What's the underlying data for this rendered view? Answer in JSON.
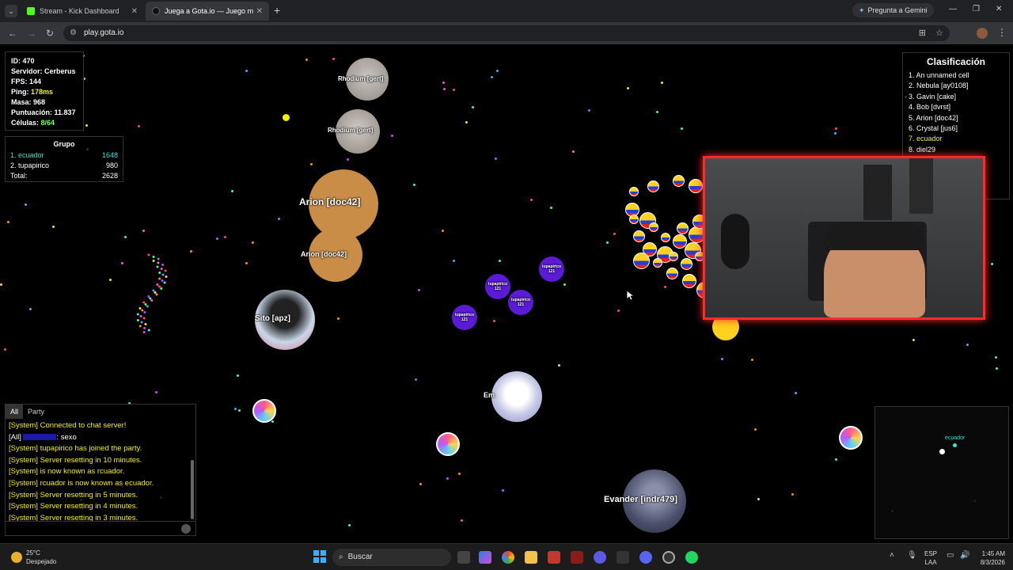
{
  "browser": {
    "tabs": [
      {
        "label": "Stream - Kick Dashboard",
        "active": false
      },
      {
        "label": "Juega a Gota.io — Juego multi",
        "active": true
      }
    ],
    "gemini_label": "Pregunta a Gemini",
    "url": "play.gota.io"
  },
  "stats": {
    "id": "ID: 470",
    "server": "Servidor: Cerberus",
    "fps": "FPS: 144",
    "ping_label": "Ping: ",
    "ping_value": "178ms",
    "mass": "Masa: 968",
    "score": "Puntuación: 11.837",
    "cells_label": "Células: ",
    "cells_value": "8/64"
  },
  "group": {
    "title": "Grupo",
    "rows": [
      {
        "name": "1. ecuador",
        "value": "1648"
      },
      {
        "name": "2. tupapirico",
        "value": "980"
      },
      {
        "name": "Total:",
        "value": "2628"
      }
    ]
  },
  "leaderboard": {
    "title": "Clasificación",
    "items": [
      "1. An unnamed cell",
      "2. Nebula [ay0108]",
      "3. Gavin [cake]",
      "4. Bob [dvrst]",
      "5. Arion [doc42]",
      "6. Crystal [jus6]",
      "7. ecuador",
      "8. diel29"
    ]
  },
  "cells": {
    "rhodium1": "Rhodium [gert]",
    "rhodium2": "Rhodium [gert]",
    "arion1": "Arion [doc42]",
    "arion2": "Arion [doc42]",
    "sito": "Sito [apz]",
    "tupa1": "tupapirico",
    "tupa1_mass": "121",
    "tupa2": "tupapirico",
    "tupa2_mass": "121",
    "tupa3": "tupapirico",
    "tupa3_mass": "121",
    "tupa4": "tupapirico",
    "tupa4_mass": "121",
    "em": "Em",
    "evander": "Evander [indr479]"
  },
  "chat": {
    "tabs": [
      "All",
      "Party"
    ],
    "messages": [
      {
        "type": "sys",
        "text": "[System] Connected to chat server!"
      },
      {
        "type": "all",
        "prefix": "[All] ",
        "text": ": sexo"
      },
      {
        "type": "sys",
        "text": "[System] tupapirico has joined the party."
      },
      {
        "type": "sys",
        "text": "[System] Server resetting in 10 minutes."
      },
      {
        "type": "sys",
        "text": "[System] is now known as rcuador."
      },
      {
        "type": "sys",
        "text": "[System] rcuador is now known as ecuador."
      },
      {
        "type": "sys",
        "text": "[System] Server resetting in 5 minutes."
      },
      {
        "type": "sys",
        "text": "[System] Server resetting in 4 minutes."
      },
      {
        "type": "sys",
        "text": "[System] Server resetting in 3 minutes."
      }
    ]
  },
  "minimap": {
    "player_label": "ecuador"
  },
  "taskbar": {
    "temp": "25°C",
    "weather": "Despejado",
    "search": "Buscar",
    "lang1": "ESP",
    "lang2": "LAA",
    "time": "1:45 AM",
    "date": "8/3/2026"
  },
  "colors": {
    "accent_yellow": "#f4f000",
    "party_cyan": "#36e0d0",
    "webcam_border": "#ff2a2a",
    "tupa_purple": "#5b1ad6"
  }
}
